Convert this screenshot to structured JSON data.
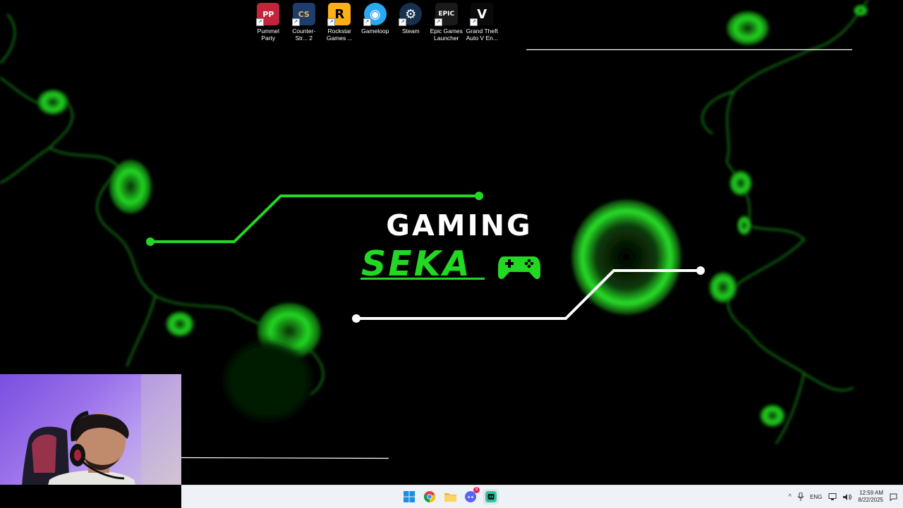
{
  "desktop_icons": [
    {
      "name": "pummel-party-icon",
      "label": "Pummel Party",
      "bg": "#c3243a",
      "glyph": "PP",
      "fg": "#ffffff"
    },
    {
      "name": "counter-strike-icon",
      "label": "Counter-Str... 2",
      "bg": "#1f3c6e",
      "glyph": "CS",
      "fg": "#f4b53f"
    },
    {
      "name": "rockstar-games-icon",
      "label": "Rockstar Games ...",
      "bg": "#fcaf17",
      "glyph": "R",
      "fg": "#000000"
    },
    {
      "name": "gameloop-icon",
      "label": "Gameloop",
      "bg": "#2aa8f2",
      "glyph": "◉",
      "fg": "#ffffff"
    },
    {
      "name": "steam-icon",
      "label": "Steam",
      "bg": "#17304e",
      "glyph": "⚙",
      "fg": "#ffffff"
    },
    {
      "name": "epic-games-icon",
      "label": "Epic Games Launcher",
      "bg": "#1a1a1a",
      "glyph": "EPIC",
      "fg": "#ffffff"
    },
    {
      "name": "gta-v-icon",
      "label": "Grand Theft Auto V En...",
      "bg": "#0a0a0a",
      "glyph": "V",
      "fg": "#ffffff"
    }
  ],
  "wallpaper": {
    "line1": "GAMING",
    "line2": "SEKA",
    "accent": "#22d822"
  },
  "taskbar": {
    "apps": [
      {
        "name": "start-button",
        "icon": "windows-icon"
      },
      {
        "name": "chrome-taskbar-button",
        "icon": "chrome-icon"
      },
      {
        "name": "file-explorer-taskbar-button",
        "icon": "folder-icon"
      },
      {
        "name": "discord-taskbar-button",
        "icon": "discord-icon",
        "badge": "9"
      },
      {
        "name": "streamlabs-taskbar-button",
        "icon": "streamlabs-icon"
      }
    ],
    "language": "ENG",
    "time": "12:59 AM",
    "date": "8/22/2025"
  }
}
